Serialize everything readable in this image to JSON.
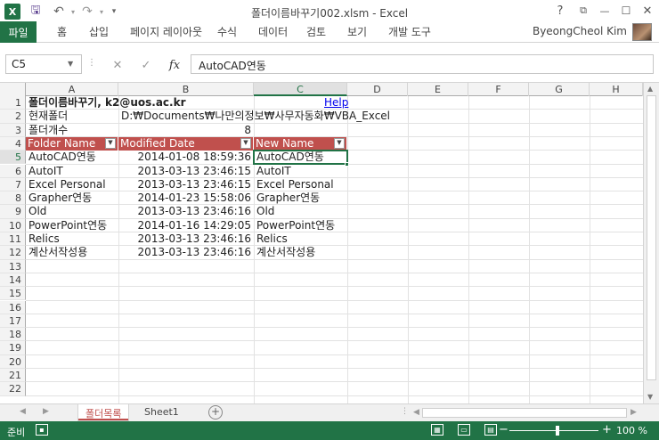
{
  "window": {
    "title": "폴더이름바꾸기002.xlsm - Excel",
    "logo": "X",
    "help": "?",
    "restore_ribbon": "⧉",
    "minimize": "—",
    "maximize": "☐",
    "close": "✕"
  },
  "quick_access": {
    "save": "💾",
    "undo": "↶",
    "redo": "↷",
    "customize": "▾"
  },
  "ribbon": {
    "tabs": [
      "파일",
      "홈",
      "삽입",
      "페이지 레이아웃",
      "수식",
      "데이터",
      "검토",
      "보기",
      "개발 도구"
    ],
    "user": "ByeongCheol Kim"
  },
  "formula_bar": {
    "name_box": "C5",
    "cancel": "✕",
    "enter": "✓",
    "fx": "fx",
    "value": "AutoCAD연동"
  },
  "grid": {
    "columns": [
      "A",
      "B",
      "C",
      "D",
      "E",
      "F",
      "G",
      "H"
    ],
    "selected_column": "C",
    "rows": [
      "1",
      "2",
      "3",
      "4",
      "5",
      "6",
      "7",
      "8",
      "9",
      "10",
      "11",
      "12",
      "13",
      "14",
      "15",
      "16",
      "17",
      "18",
      "19",
      "20",
      "21",
      "22"
    ],
    "selected_row": "5",
    "r1": {
      "a": "폴더이름바꾸기, k2@uos.ac.kr",
      "c": "Help"
    },
    "r2": {
      "a": "현재폴더",
      "b": "D:₩Documents₩나만의정보₩사무자동화₩VBA_Excel"
    },
    "r3": {
      "a": "폴더개수",
      "b": "8"
    },
    "table_headers": [
      "Folder Name",
      "Modified Date",
      "New Name"
    ],
    "table_rows": [
      {
        "name": "AutoCAD연동",
        "date": "2014-01-08 18:59:36",
        "new": "AutoCAD연동"
      },
      {
        "name": "AutoIT",
        "date": "2013-03-13 23:46:15",
        "new": "AutoIT"
      },
      {
        "name": "Excel Personal",
        "date": "2013-03-13 23:46:15",
        "new": "Excel Personal"
      },
      {
        "name": "Grapher연동",
        "date": "2014-01-23 15:58:06",
        "new": "Grapher연동"
      },
      {
        "name": "Old",
        "date": "2013-03-13 23:46:16",
        "new": "Old"
      },
      {
        "name": "PowerPoint연동",
        "date": "2014-01-16 14:29:05",
        "new": "PowerPoint연동"
      },
      {
        "name": "Relics",
        "date": "2013-03-13 23:46:16",
        "new": "Relics"
      },
      {
        "name": "계산서작성용",
        "date": "2013-03-13 23:46:16",
        "new": "계산서작성용"
      }
    ]
  },
  "sheets": {
    "tabs": [
      "폴더목록",
      "Sheet1"
    ],
    "active": "폴더목록",
    "add": "+"
  },
  "status": {
    "ready": "준비",
    "zoom": "100 %",
    "zoom_out": "−",
    "zoom_in": "+"
  },
  "colors": {
    "accent": "#217346",
    "table_header": "#c0504d"
  }
}
